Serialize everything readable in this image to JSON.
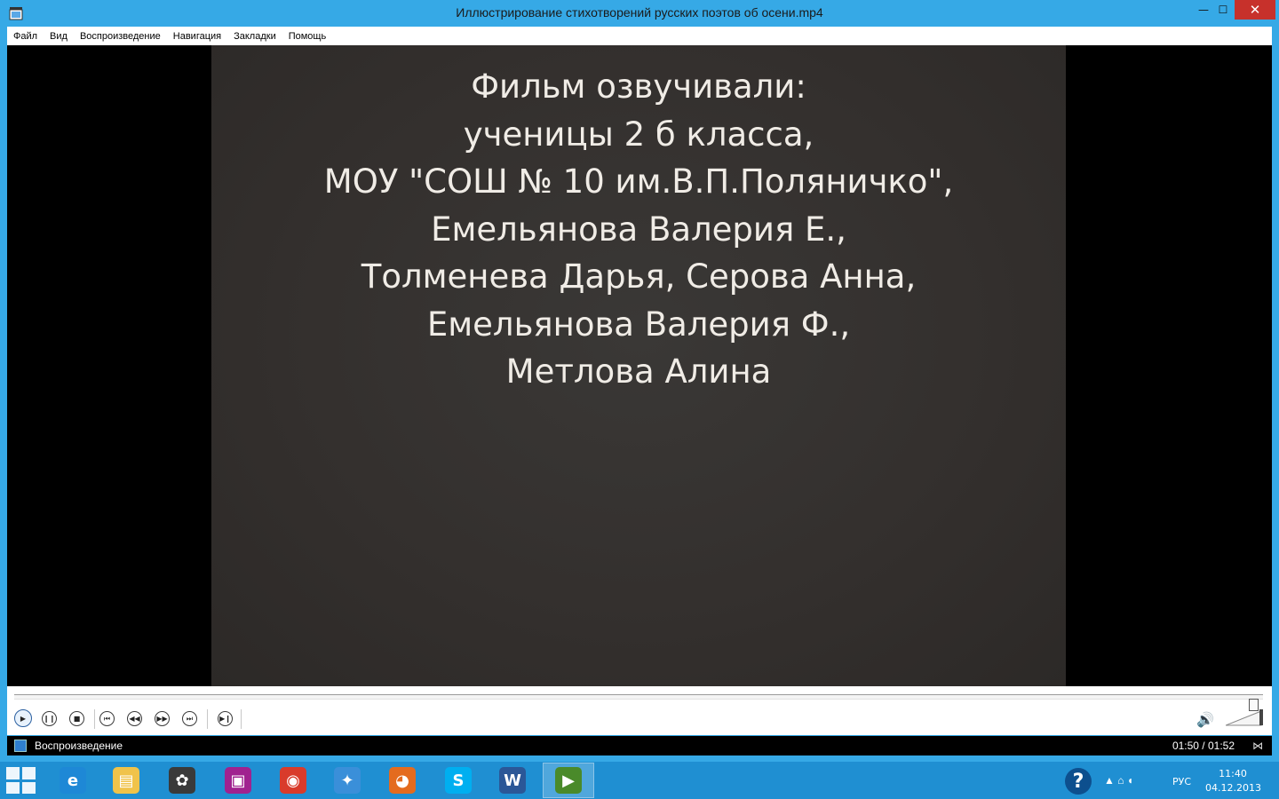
{
  "window": {
    "title": "Иллюстрирование стихотворений русских поэтов об осени.mp4",
    "min": "—",
    "max": "☐",
    "close": "✕"
  },
  "menu": [
    "Файл",
    "Вид",
    "Воспроизведение",
    "Навигация",
    "Закладки",
    "Помощь"
  ],
  "video": {
    "lines": [
      "Фильм озвучивали:",
      "ученицы 2 б класса,",
      "МОУ \"СОШ № 10 им.В.П.Поляничко\",",
      "Емельянова Валерия Е.,",
      "Толменева Дарья, Серова Анна,",
      "Емельянова Валерия Ф.,",
      "Метлова Алина"
    ]
  },
  "controls": {
    "play": "▶",
    "pause": "❙❙",
    "stop": "■",
    "prev": "⏮",
    "rewind": "◀◀",
    "forward": "▶▶",
    "next": "⏭",
    "step": "▶❙",
    "volume_icon": "🔊",
    "seek_progress": 0.99
  },
  "status": {
    "label": "Воспроизведение",
    "time": "01:50 / 01:52",
    "end_icon": "⋈"
  },
  "taskbar": {
    "apps": [
      {
        "name": "ie",
        "glyph": "e",
        "color": "#1e88d6"
      },
      {
        "name": "explorer",
        "glyph": "▤",
        "color": "#f0c34a"
      },
      {
        "name": "media",
        "glyph": "✿",
        "color": "#3a3a3a"
      },
      {
        "name": "remote",
        "glyph": "▣",
        "color": "#a0228f"
      },
      {
        "name": "chrome",
        "glyph": "◉",
        "color": "#d93b2b"
      },
      {
        "name": "safari",
        "glyph": "✦",
        "color": "#3a8fd9"
      },
      {
        "name": "firefox",
        "glyph": "◕",
        "color": "#e46b1e"
      },
      {
        "name": "skype",
        "glyph": "S",
        "color": "#00aff0"
      },
      {
        "name": "word",
        "glyph": "W",
        "color": "#2b5797"
      },
      {
        "name": "media-player",
        "glyph": "▶",
        "color": "#4a8a2a"
      }
    ],
    "help": "?",
    "tray_glyphs": "▲  ⌂  ◖",
    "lang": "РУС",
    "time": "11:40",
    "date": "04.12.2013"
  }
}
